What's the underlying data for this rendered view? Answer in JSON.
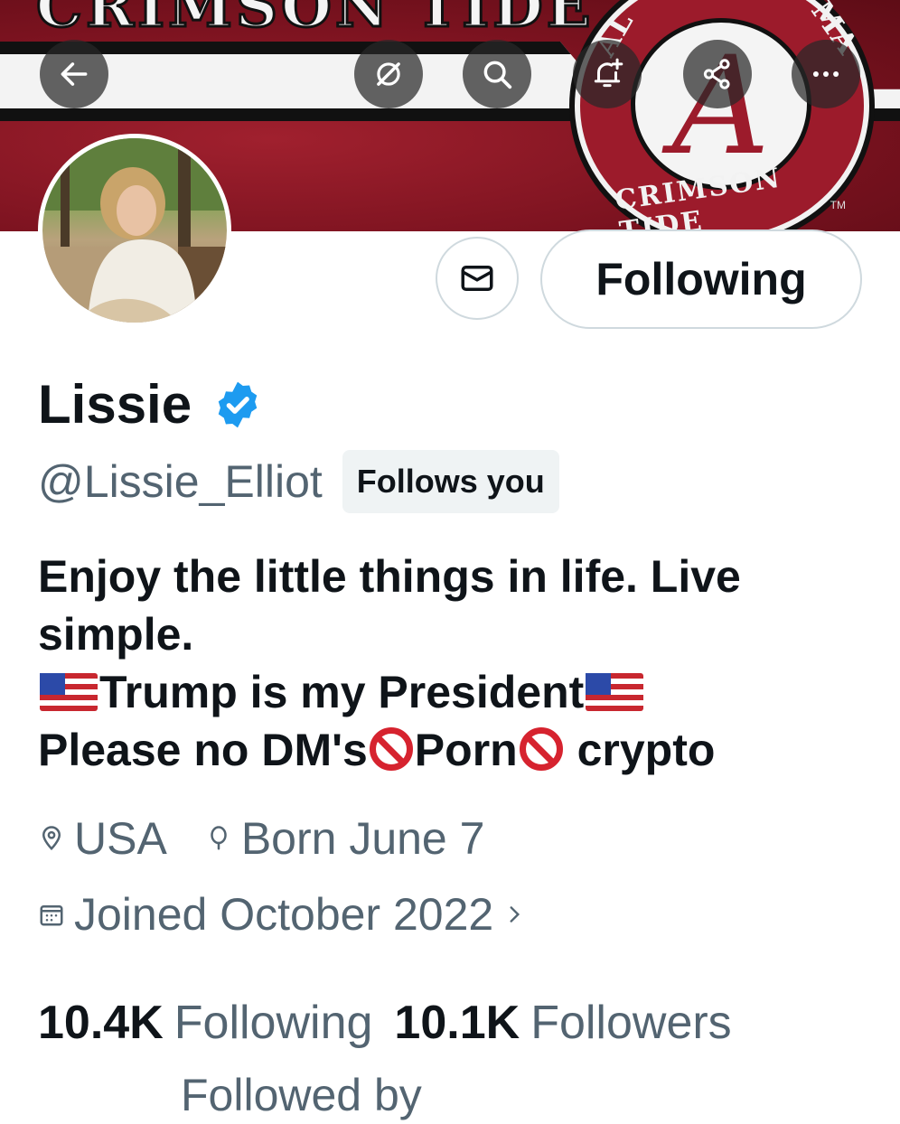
{
  "banner": {
    "wordmark": "CRIMSON TIDE",
    "seal_letter": "A",
    "seal_ring_bottom": "CRIMSON TIDE",
    "seal_ring_left": "AL",
    "seal_ring_right": "MA",
    "tm": "TM"
  },
  "header_icons": {
    "back": "arrow-left-icon",
    "grok": "grok-icon",
    "search": "search-icon",
    "notify": "bell-plus-icon",
    "share": "share-icon",
    "more": "more-icon"
  },
  "actions": {
    "message_icon": "envelope-icon",
    "follow_label": "Following"
  },
  "profile": {
    "name": "Lissie",
    "handle": "@Lissie_Elliot",
    "follows_you": "Follows you",
    "bio": {
      "line1": "Enjoy the little things in life. Live",
      "line2": "simple.",
      "line3_text": "Trump is my President",
      "line4_a": "Please no DM's",
      "line4_b": "Porn",
      "line4_c": " crypto"
    },
    "location": "USA",
    "birthday": "Born June 7",
    "joined": "Joined October 2022"
  },
  "stats": {
    "following_count": "10.4K",
    "following_label": "Following",
    "followers_count": "10.1K",
    "followers_label": "Followers"
  },
  "followed_by": "Followed by"
}
